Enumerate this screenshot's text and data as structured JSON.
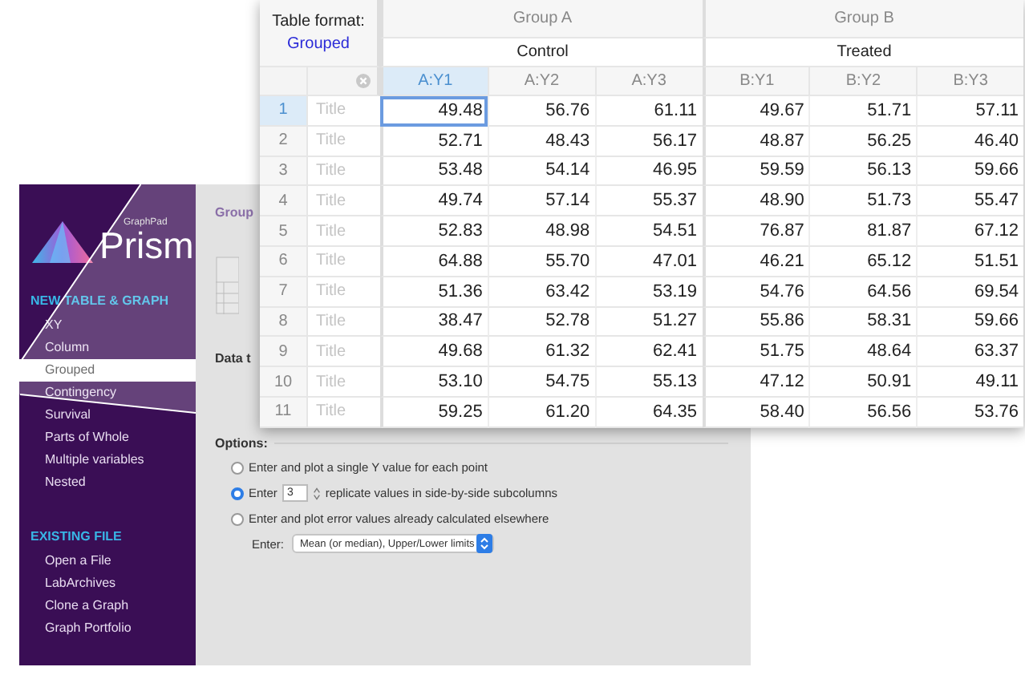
{
  "sidebar": {
    "logo": {
      "small": "GraphPad",
      "name": "Prism"
    },
    "sections": [
      {
        "heading": "NEW TABLE & GRAPH",
        "items": [
          {
            "label": "XY",
            "selected": false
          },
          {
            "label": "Column",
            "selected": false
          },
          {
            "label": "Grouped",
            "selected": true
          },
          {
            "label": "Contingency",
            "selected": false
          },
          {
            "label": "Survival",
            "selected": false
          },
          {
            "label": "Parts of Whole",
            "selected": false
          },
          {
            "label": "Multiple variables",
            "selected": false
          },
          {
            "label": "Nested",
            "selected": false
          }
        ]
      },
      {
        "heading": "EXISTING FILE",
        "items": [
          {
            "label": "Open a File",
            "selected": false
          },
          {
            "label": "LabArchives",
            "selected": false
          },
          {
            "label": "Clone a Graph",
            "selected": false
          },
          {
            "label": "Graph Portfolio",
            "selected": false
          }
        ]
      }
    ]
  },
  "content": {
    "title": "Group",
    "data_label": "Data t",
    "options_label": "Options:",
    "options": [
      {
        "kind": "plain",
        "selected": false,
        "label": "Enter and plot a single Y value for each point"
      },
      {
        "kind": "replicates",
        "selected": true,
        "label": "Enter",
        "value": "3",
        "suffix": "replicate values in side-by-side subcolumns"
      },
      {
        "kind": "error",
        "selected": false,
        "label": "Enter and plot error values already calculated elsewhere",
        "sub_label": "Enter:",
        "select": "Mean (or median), Upper/Lower limits"
      }
    ]
  },
  "table": {
    "format_label": "Table format:",
    "format_value": "Grouped",
    "groups": [
      {
        "name": "Group A",
        "dataset": "Control",
        "columns": [
          {
            "label": "A:Y1",
            "selected": true
          },
          {
            "label": "A:Y2",
            "selected": false
          },
          {
            "label": "A:Y3",
            "selected": false
          }
        ]
      },
      {
        "name": "Group B",
        "dataset": "Treated",
        "columns": [
          {
            "label": "B:Y1",
            "selected": false
          },
          {
            "label": "B:Y2",
            "selected": false
          },
          {
            "label": "B:Y3",
            "selected": false
          }
        ]
      }
    ],
    "rows": [
      {
        "number": "1",
        "placeholder": "Title",
        "selected": true,
        "cells": [
          {
            "value": "49.48",
            "selected": true
          },
          {
            "value": "56.76",
            "selected": false
          },
          {
            "value": "61.11",
            "selected": false
          },
          {
            "value": "49.67",
            "selected": false
          },
          {
            "value": "51.71",
            "selected": false
          },
          {
            "value": "57.11",
            "selected": false
          }
        ]
      },
      {
        "number": "2",
        "placeholder": "Title",
        "selected": false,
        "cells": [
          {
            "value": "52.71",
            "selected": false
          },
          {
            "value": "48.43",
            "selected": false
          },
          {
            "value": "56.17",
            "selected": false
          },
          {
            "value": "48.87",
            "selected": false
          },
          {
            "value": "56.25",
            "selected": false
          },
          {
            "value": "46.40",
            "selected": false
          }
        ]
      },
      {
        "number": "3",
        "placeholder": "Title",
        "selected": false,
        "cells": [
          {
            "value": "53.48",
            "selected": false
          },
          {
            "value": "54.14",
            "selected": false
          },
          {
            "value": "46.95",
            "selected": false
          },
          {
            "value": "59.59",
            "selected": false
          },
          {
            "value": "56.13",
            "selected": false
          },
          {
            "value": "59.66",
            "selected": false
          }
        ]
      },
      {
        "number": "4",
        "placeholder": "Title",
        "selected": false,
        "cells": [
          {
            "value": "49.74",
            "selected": false
          },
          {
            "value": "57.14",
            "selected": false
          },
          {
            "value": "55.37",
            "selected": false
          },
          {
            "value": "48.90",
            "selected": false
          },
          {
            "value": "51.73",
            "selected": false
          },
          {
            "value": "55.47",
            "selected": false
          }
        ]
      },
      {
        "number": "5",
        "placeholder": "Title",
        "selected": false,
        "cells": [
          {
            "value": "52.83",
            "selected": false
          },
          {
            "value": "48.98",
            "selected": false
          },
          {
            "value": "54.51",
            "selected": false
          },
          {
            "value": "76.87",
            "selected": false
          },
          {
            "value": "81.87",
            "selected": false
          },
          {
            "value": "67.12",
            "selected": false
          }
        ]
      },
      {
        "number": "6",
        "placeholder": "Title",
        "selected": false,
        "cells": [
          {
            "value": "64.88",
            "selected": false
          },
          {
            "value": "55.70",
            "selected": false
          },
          {
            "value": "47.01",
            "selected": false
          },
          {
            "value": "46.21",
            "selected": false
          },
          {
            "value": "65.12",
            "selected": false
          },
          {
            "value": "51.51",
            "selected": false
          }
        ]
      },
      {
        "number": "7",
        "placeholder": "Title",
        "selected": false,
        "cells": [
          {
            "value": "51.36",
            "selected": false
          },
          {
            "value": "63.42",
            "selected": false
          },
          {
            "value": "53.19",
            "selected": false
          },
          {
            "value": "54.76",
            "selected": false
          },
          {
            "value": "64.56",
            "selected": false
          },
          {
            "value": "69.54",
            "selected": false
          }
        ]
      },
      {
        "number": "8",
        "placeholder": "Title",
        "selected": false,
        "cells": [
          {
            "value": "38.47",
            "selected": false
          },
          {
            "value": "52.78",
            "selected": false
          },
          {
            "value": "51.27",
            "selected": false
          },
          {
            "value": "55.86",
            "selected": false
          },
          {
            "value": "58.31",
            "selected": false
          },
          {
            "value": "59.66",
            "selected": false
          }
        ]
      },
      {
        "number": "9",
        "placeholder": "Title",
        "selected": false,
        "cells": [
          {
            "value": "49.68",
            "selected": false
          },
          {
            "value": "61.32",
            "selected": false
          },
          {
            "value": "62.41",
            "selected": false
          },
          {
            "value": "51.75",
            "selected": false
          },
          {
            "value": "48.64",
            "selected": false
          },
          {
            "value": "63.37",
            "selected": false
          }
        ]
      },
      {
        "number": "10",
        "placeholder": "Title",
        "selected": false,
        "cells": [
          {
            "value": "53.10",
            "selected": false
          },
          {
            "value": "54.75",
            "selected": false
          },
          {
            "value": "55.13",
            "selected": false
          },
          {
            "value": "47.12",
            "selected": false
          },
          {
            "value": "50.91",
            "selected": false
          },
          {
            "value": "49.11",
            "selected": false
          }
        ]
      },
      {
        "number": "11",
        "placeholder": "Title",
        "selected": false,
        "cells": [
          {
            "value": "59.25",
            "selected": false
          },
          {
            "value": "61.20",
            "selected": false
          },
          {
            "value": "64.35",
            "selected": false
          },
          {
            "value": "58.40",
            "selected": false
          },
          {
            "value": "56.56",
            "selected": false
          },
          {
            "value": "53.76",
            "selected": false
          }
        ]
      }
    ]
  }
}
